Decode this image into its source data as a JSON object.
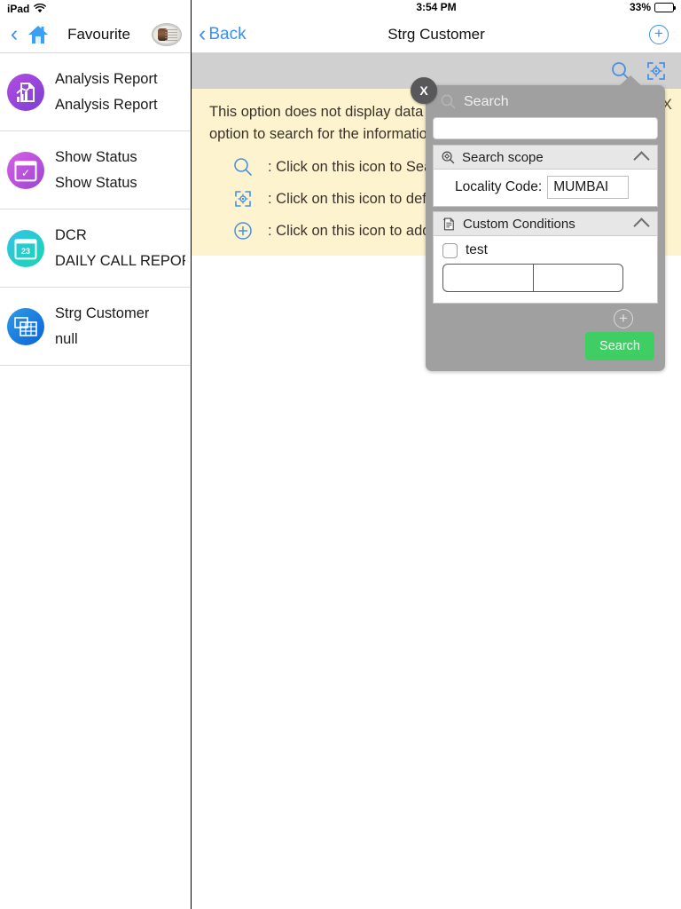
{
  "left": {
    "status": {
      "device": "iPad",
      "wifi_icon": "wifi-icon"
    },
    "nav": {
      "back_icon": "chevron-left-icon",
      "home_icon": "home-icon",
      "title": "Favourite",
      "avatar_icon": "avatar"
    },
    "favourites": [
      {
        "title": "Analysis Report",
        "subtitle": "Analysis Report",
        "icon": "report-document-icon",
        "color_from": "#b44ce0",
        "color_to": "#7a3fd4"
      },
      {
        "title": "Show Status",
        "subtitle": "Show Status",
        "icon": "calendar-check-icon",
        "color_from": "#d85fe8",
        "color_to": "#9a46cf"
      },
      {
        "title": "DCR",
        "subtitle": "DAILY CALL REPORT",
        "icon": "calendar-23-icon",
        "color_from": "#35c2e8",
        "color_to": "#18d6b0",
        "badge": "23"
      },
      {
        "title": "Strg Customer",
        "subtitle": "null",
        "icon": "table-grid-icon",
        "color_from": "#2f9ae8",
        "color_to": "#0b63d6"
      }
    ]
  },
  "right": {
    "status": {
      "time": "3:54 PM",
      "battery_percent": "33%",
      "battery_level": 33
    },
    "nav": {
      "back_label": "Back",
      "back_icon": "chevron-left-icon",
      "title": "Strg Customer",
      "add_icon": "plus-circle-icon",
      "add_label": "+"
    },
    "toolbar": {
      "search_icon": "search-icon",
      "locate_icon": "target-locate-icon"
    },
    "info_banner": {
      "close_label": "X",
      "paragraph": "This option does not display data by default. Please use the Search option to search for the information you need.",
      "hints": [
        {
          "icon": "search-icon",
          "text": ": Click on this icon to Search the data"
        },
        {
          "icon": "target-locate-icon",
          "text": ": Click on this icon to define the search scope"
        },
        {
          "icon": "plus-circle-icon",
          "text": ": Click on this icon to add New record"
        }
      ]
    }
  },
  "popover": {
    "close_label": "X",
    "header_icon": "search-icon",
    "header_title": "Search",
    "search_input_value": "",
    "search_input_placeholder": "",
    "sections": [
      {
        "icon": "search-scope-icon",
        "title": "Search scope",
        "collapse_icon": "chevron-up-icon",
        "fields": [
          {
            "label": "Locality Code:",
            "value": "MUMBAI"
          }
        ]
      },
      {
        "icon": "custom-conditions-icon",
        "title": "Custom Conditions",
        "collapse_icon": "chevron-up-icon",
        "condition": {
          "checkbox_label": "test",
          "checked": false,
          "input_left_value": "",
          "input_right_value": ""
        }
      }
    ],
    "add_condition_icon": "plus-circle-icon",
    "add_condition_label": "+",
    "search_button_label": "Search",
    "accent_color": "#3fce63",
    "header_bg": "#a0a0a0"
  }
}
